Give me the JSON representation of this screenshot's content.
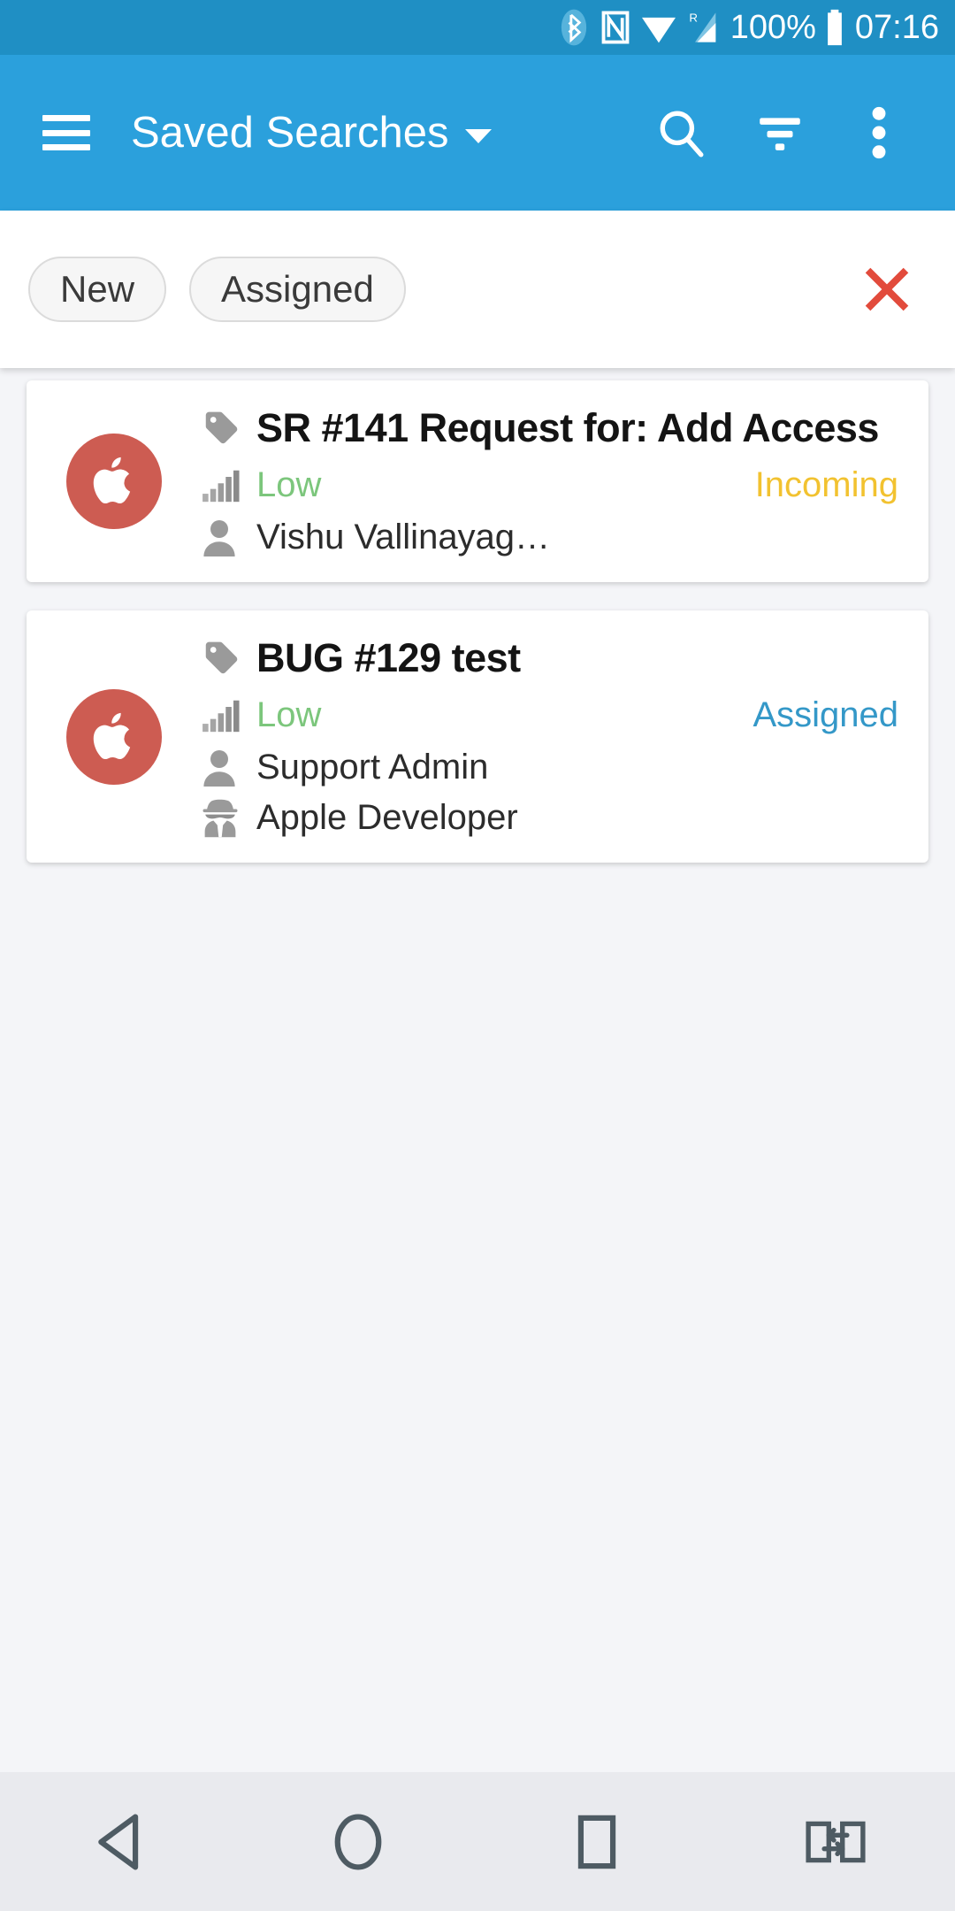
{
  "statusbar": {
    "bluetooth_icon": "bluetooth-icon",
    "nfc_icon": "nfc-icon",
    "wifi_icon": "wifi-icon",
    "signal_icon": "cellular-signal-roaming-icon",
    "battery_percent": "100%",
    "battery_icon": "battery-full-icon",
    "time": "07:16"
  },
  "appbar": {
    "menu_icon": "hamburger-menu-icon",
    "title": "Saved Searches",
    "dropdown_icon": "chevron-down-icon",
    "search_icon": "search-icon",
    "filter_icon": "filter-icon",
    "overflow_icon": "more-vertical-icon",
    "background_color": "#2BA0DC"
  },
  "filterbar": {
    "chips": [
      {
        "label": "New"
      },
      {
        "label": "Assigned"
      }
    ],
    "clear_icon": "close-x-icon",
    "clear_color": "#E24B3C"
  },
  "cards": [
    {
      "avatar_icon": "apple-logo-icon",
      "avatar_color": "#CD5C52",
      "tag_icon": "tag-icon",
      "title": "SR #141 Request for: Add Access",
      "priority_icon": "signal-bars-icon",
      "priority": "Low",
      "priority_color": "#7CC67C",
      "status": "Incoming",
      "status_color": "#F2C230",
      "people": [
        {
          "icon": "person-icon",
          "name": "Vishu Vallinayag…"
        }
      ]
    },
    {
      "avatar_icon": "apple-logo-icon",
      "avatar_color": "#CD5C52",
      "tag_icon": "tag-icon",
      "title": "BUG #129 test",
      "priority_icon": "signal-bars-icon",
      "priority": "Low",
      "priority_color": "#7CC67C",
      "status": "Assigned",
      "status_color": "#3498C8",
      "people": [
        {
          "icon": "person-icon",
          "name": "Support Admin"
        },
        {
          "icon": "detective-icon",
          "name": "Apple Developer"
        }
      ]
    }
  ],
  "navbar": {
    "back_icon": "back-triangle-icon",
    "home_icon": "home-circle-icon",
    "recents_icon": "recents-square-icon",
    "switch_icon": "switch-apps-icon"
  }
}
